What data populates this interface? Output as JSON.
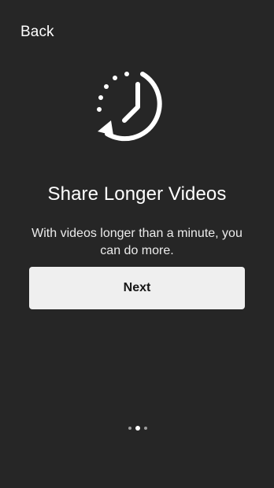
{
  "header": {
    "back_label": "Back"
  },
  "intro": {
    "icon": "clock-history-icon",
    "title": "Share Longer Videos",
    "description": "With videos longer than a minute, you can do more.",
    "next_label": "Next"
  },
  "pager": {
    "current_page": 2,
    "total_pages": 3
  },
  "colors": {
    "background": "#262626",
    "text": "#ffffff",
    "button_background": "#efefef",
    "button_text": "#161616",
    "inactive_dot": "#9e9e9e",
    "active_dot": "#ffffff"
  }
}
